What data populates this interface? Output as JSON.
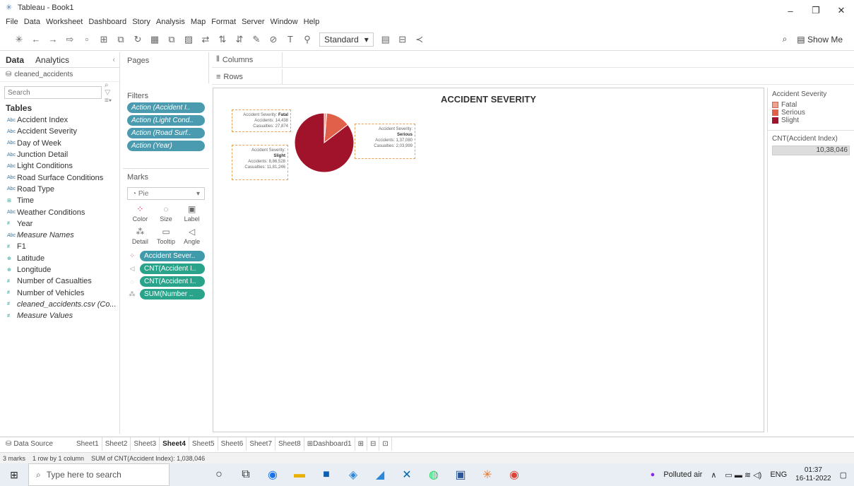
{
  "window": {
    "title": "Tableau - Book1",
    "controls": [
      "–",
      "❐",
      "✕"
    ]
  },
  "menu": [
    "File",
    "Data",
    "Worksheet",
    "Dashboard",
    "Story",
    "Analysis",
    "Map",
    "Format",
    "Server",
    "Window",
    "Help"
  ],
  "toolbar": {
    "fit": "Standard",
    "show_me": "Show Me"
  },
  "data_pane": {
    "tab_data": "Data",
    "tab_analytics": "Analytics",
    "datasource": "cleaned_accidents",
    "search_placeholder": "Search",
    "tables_header": "Tables",
    "fields": [
      {
        "type": "Abc",
        "name": "Accident Index"
      },
      {
        "type": "Abc",
        "name": "Accident Severity"
      },
      {
        "type": "Abc",
        "name": "Day of Week"
      },
      {
        "type": "Abc",
        "name": "Junction Detail"
      },
      {
        "type": "Abc",
        "name": "Light Conditions"
      },
      {
        "type": "Abc",
        "name": "Road Surface Conditions"
      },
      {
        "type": "Abc",
        "name": "Road Type"
      },
      {
        "type": "⊞",
        "name": "Time"
      },
      {
        "type": "Abc",
        "name": "Weather Conditions"
      },
      {
        "type": "#",
        "name": "Year"
      },
      {
        "type": "Abc",
        "name": "Measure Names"
      },
      {
        "type": "#",
        "name": "F1"
      },
      {
        "type": "⊕",
        "name": "Latitude"
      },
      {
        "type": "⊕",
        "name": "Longitude"
      },
      {
        "type": "#",
        "name": "Number of Casualties"
      },
      {
        "type": "#",
        "name": "Number of Vehicles"
      },
      {
        "type": "#",
        "name": "cleaned_accidents.csv (Co..."
      },
      {
        "type": "#",
        "name": "Measure Values"
      }
    ]
  },
  "shelves": {
    "pages": "Pages",
    "filters": "Filters",
    "filter_pills": [
      "Action (Accident I..",
      "Action (Light Cond..",
      "Action (Road Surf..",
      "Action (Year)"
    ],
    "columns": "Columns",
    "rows": "Rows",
    "marks": "Marks",
    "mark_type": "Pie",
    "mark_buttons": [
      "Color",
      "Size",
      "Label",
      "Detail",
      "Tooltip",
      "Angle"
    ],
    "mark_pills": [
      "Accident Sever..",
      "CNT(Accident I..",
      "CNT(Accident I..",
      "SUM(Number .."
    ]
  },
  "viz": {
    "title": "ACCIDENT SEVERITY",
    "tooltips": {
      "fatal": {
        "severity_label": "Accident Severity:",
        "severity": "Fatal",
        "accidents": "Accidents: 14,438",
        "casualties": "Casualties: 27,874"
      },
      "serious": {
        "severity_label": "Accident Severity:",
        "severity": "Serious",
        "accidents": "Accidents: 1,37,080",
        "casualties": "Casualties: 2,03,999"
      },
      "slight": {
        "severity_label": "Accident Severity:",
        "severity": "Slight",
        "accidents": "Accidents: 8,86,528",
        "casualties": "Casualties: 11,81,246"
      }
    }
  },
  "chart_data": {
    "type": "pie",
    "title": "ACCIDENT SEVERITY",
    "categories": [
      "Fatal",
      "Serious",
      "Slight"
    ],
    "values": [
      14438,
      137080,
      886528
    ],
    "colors": [
      "#f0a18e",
      "#e0604a",
      "#a1122b"
    ],
    "legend": "right"
  },
  "legend": {
    "title": "Accident Severity",
    "items": [
      {
        "label": "Fatal",
        "color": "#f0a18e"
      },
      {
        "label": "Serious",
        "color": "#e0604a"
      },
      {
        "label": "Slight",
        "color": "#a1122b"
      }
    ],
    "size_title": "CNT(Accident Index)",
    "size_value": "10,38,046"
  },
  "sheets": {
    "data_source": "Data Source",
    "tabs": [
      "Sheet1",
      "Sheet2",
      "Sheet3",
      "Sheet4",
      "Sheet5",
      "Sheet6",
      "Sheet7",
      "Sheet8",
      "Dashboard1"
    ],
    "active": "Sheet4"
  },
  "status": {
    "marks": "3 marks",
    "layout": "1 row by 1 column",
    "sum": "SUM of CNT(Accident Index): 1,038,046"
  },
  "taskbar": {
    "search_placeholder": "Type here to search",
    "weather": "Polluted air",
    "lang": "ENG",
    "time": "01:37",
    "date": "16-11-2022"
  }
}
